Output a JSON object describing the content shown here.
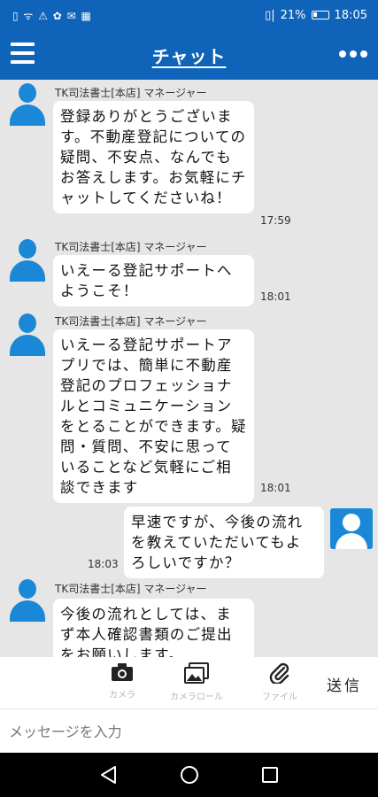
{
  "status_bar": {
    "left_icons": "▯ ᯤ ⚠ ✿ ✉ ▦",
    "signal_text": "▯|",
    "battery_text": "21%",
    "time": "18:05"
  },
  "header": {
    "title": "チャット",
    "menu_icon": "hamburger-menu-icon",
    "more_icon": "more-dots-icon"
  },
  "messages": [
    {
      "sender": "TK司法書士[本店] マネージャー",
      "text": "登録ありがとうございます。不動産登記についての疑問、不安点、なんでもお答えします。お気軽にチャットしてくださいね！",
      "time": "17:59"
    },
    {
      "sender": "TK司法書士[本店] マネージャー",
      "text": "いえーる登記サポートへようこそ！",
      "time": "18:01"
    },
    {
      "sender": "TK司法書士[本店] マネージャー",
      "text": "いえーる登記サポートアプリでは、簡単に不動産登記のプロフェッショナルとコミュニケーションをとることができます。疑問・質問、不安に思っていることなど気軽にご相談できます",
      "time": "18:01"
    },
    {
      "outgoing": true,
      "text": "早速ですが、今後の流れを教えていただいてもよろしいですか？",
      "time": "18:03"
    },
    {
      "sender": "TK司法書士[本店] マネージャー",
      "text": "今後の流れとしては、まず本人確認書類のご提出をお願いします。",
      "time": ""
    }
  ],
  "toolbar": {
    "camera_label": "カメラ",
    "camera_roll_label": "カメラロール",
    "file_label": "ファイル",
    "send_label": "送信"
  },
  "input": {
    "placeholder": "メッセージを入力",
    "value": ""
  },
  "colors": {
    "header_blue": "#0f63b8",
    "avatar_blue": "#1a88d6",
    "chat_bg": "#e6e6e6"
  }
}
